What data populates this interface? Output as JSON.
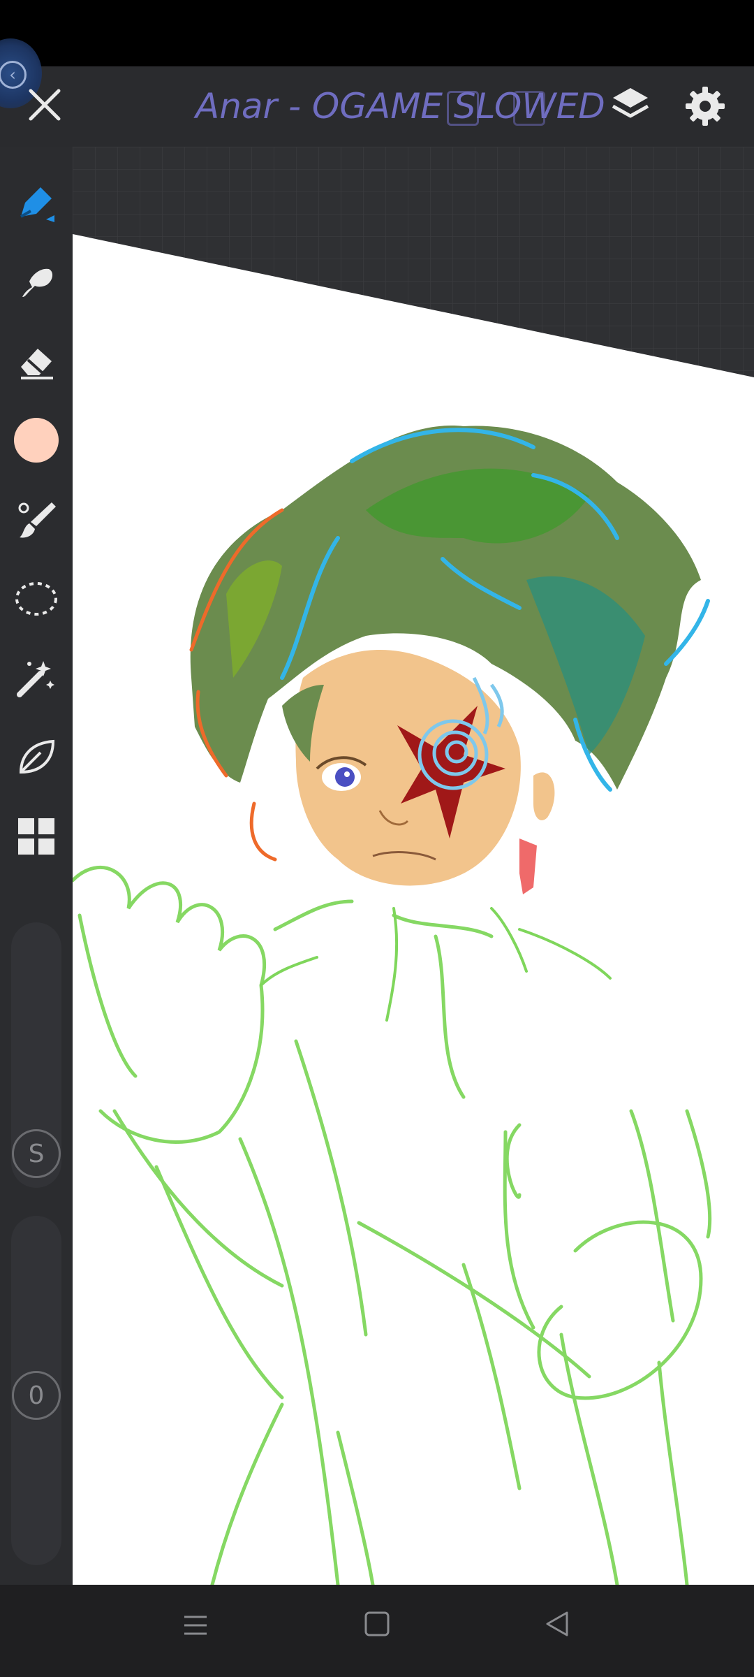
{
  "app": {
    "title": "Anar - OGAME SLOWED"
  },
  "toolbar": {
    "close_icon": "close-icon",
    "layers_icon": "layers-icon",
    "settings_icon": "gear-icon"
  },
  "sidebar": {
    "tools": [
      {
        "name": "brush-tool",
        "icon": "pen-icon",
        "active": true
      },
      {
        "name": "smudge-tool",
        "icon": "smudge-icon"
      },
      {
        "name": "eraser-tool",
        "icon": "eraser-icon"
      },
      {
        "name": "color-swatch",
        "icon": "color-circle-icon",
        "color": "#ffd1bd"
      },
      {
        "name": "brush-settings-tool",
        "icon": "brush-icon"
      },
      {
        "name": "lasso-tool",
        "icon": "lasso-icon"
      },
      {
        "name": "magic-wand-tool",
        "icon": "magic-wand-icon"
      },
      {
        "name": "transform-tool",
        "icon": "leaf-icon"
      },
      {
        "name": "more-tools",
        "icon": "grid-icon"
      }
    ],
    "size_slider_label": "S",
    "opacity_slider_label": "0"
  },
  "navigation": {
    "menu_icon": "menu-icon",
    "home_icon": "home-square-icon",
    "back_icon": "back-triangle-icon"
  },
  "colors": {
    "accent": "#1f8fe6",
    "title": "#6f6dc0",
    "swatch": "#ffd1bd"
  }
}
